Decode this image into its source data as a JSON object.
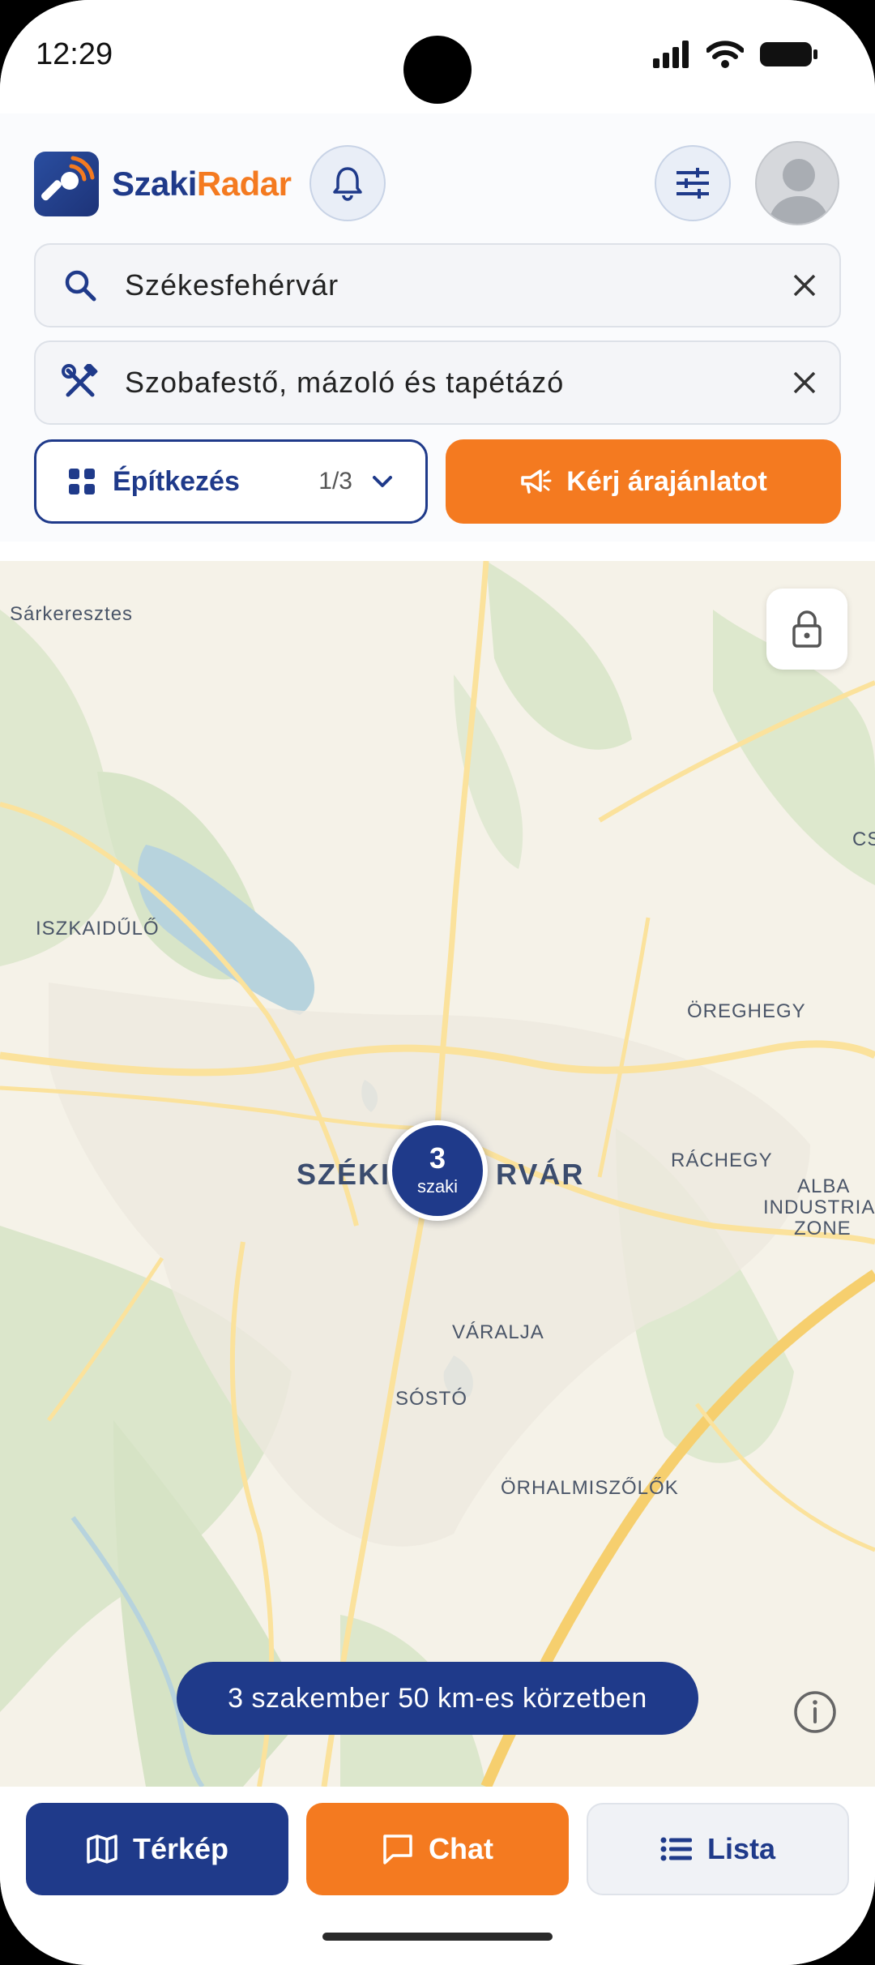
{
  "status_bar": {
    "time": "12:29"
  },
  "app": {
    "logo_part1": "Szaki",
    "logo_part2": "Radar"
  },
  "search": {
    "location_value": "Székesfehérvár",
    "trade_value": "Szobafestő, mázoló és tapétázó"
  },
  "category": {
    "label": "Építkezés",
    "counter": "1/3"
  },
  "quote_button": {
    "label": "Kérj árajánlatot"
  },
  "map": {
    "places": {
      "sarkeresztes": "Sárkeresztes",
      "iszkaidulo": "ISZKAIDŰLŐ",
      "oreghegy": "ÖREGHEGY",
      "rachegy": "RÁCHEGY",
      "alba1": "ALBA",
      "alba2": "INDUSTRIAL",
      "alba3": "ZONE",
      "varalja": "VÁRALJA",
      "sosto": "SÓSTÓ",
      "orhalmi": "ÖRHALMISZŐLŐK",
      "cs": "CS",
      "city_left": "SZÉKI",
      "city_right": "RVÁR"
    },
    "cluster": {
      "count": "3",
      "unit": "szaki"
    },
    "summary": "3 szakember 50 km-es körzetben"
  },
  "nav": {
    "map": "Térkép",
    "chat": "Chat",
    "list": "Lista"
  },
  "colors": {
    "primary": "#1f3a8a",
    "accent": "#f47a20"
  }
}
